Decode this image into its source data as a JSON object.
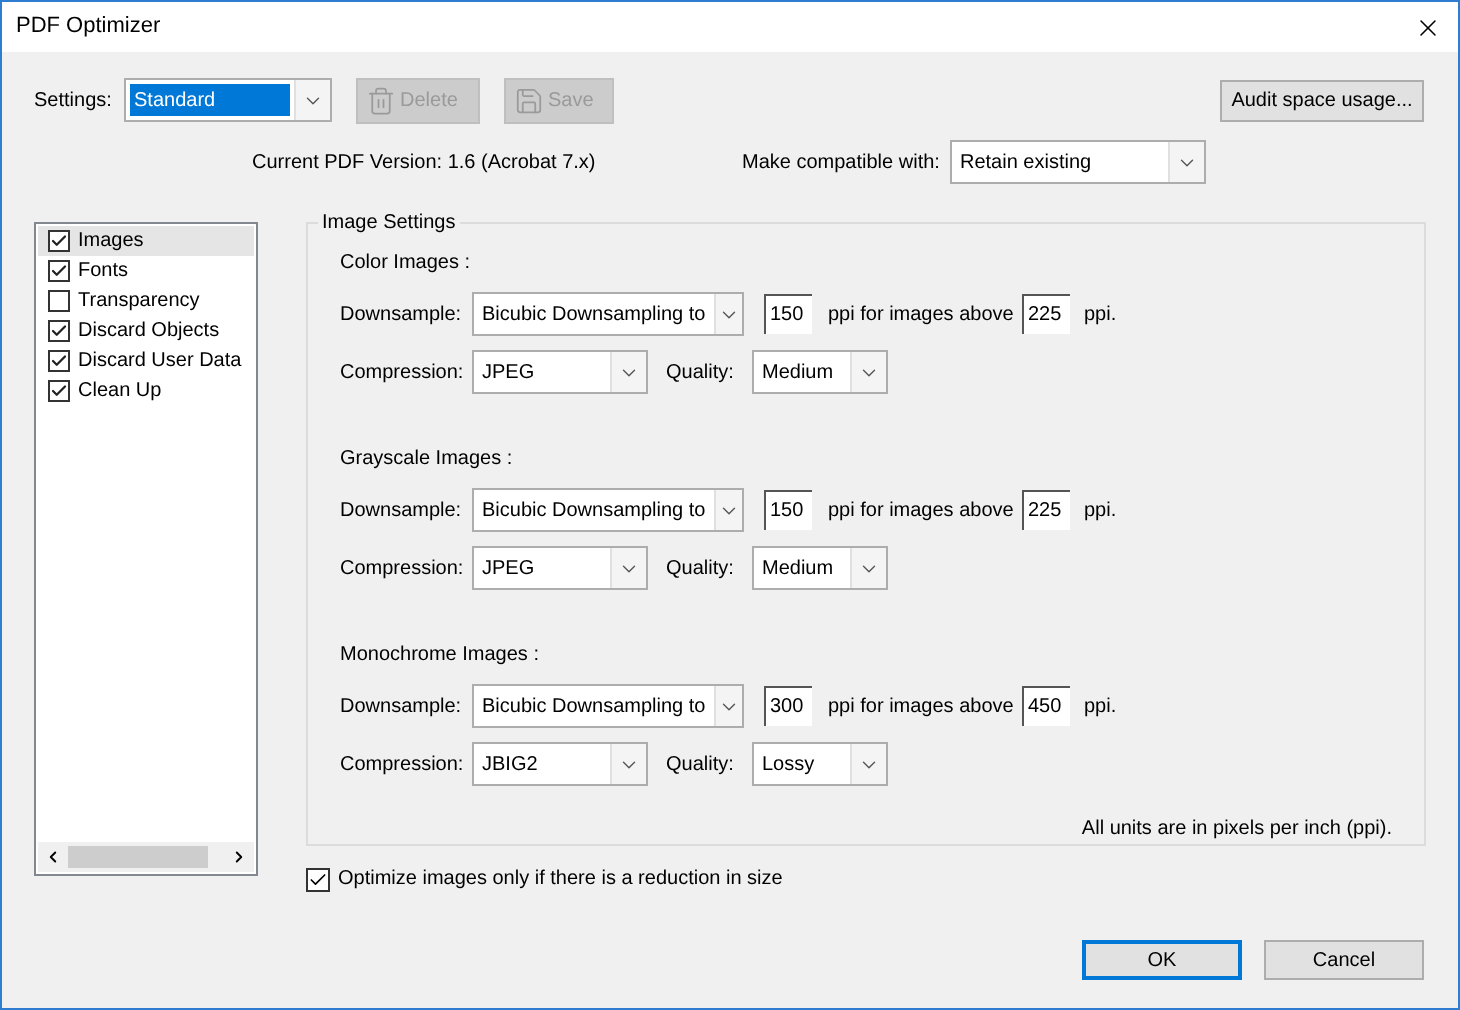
{
  "window": {
    "title": "PDF Optimizer"
  },
  "settings": {
    "label": "Settings:",
    "value": "Standard"
  },
  "toolbar_buttons": [
    {
      "label": "Delete",
      "disabled": true,
      "kind": "delete"
    },
    {
      "label": "Save",
      "disabled": true,
      "kind": "save"
    }
  ],
  "audit_button": "Audit space usage...",
  "current_version": "Current PDF Version: 1.6 (Acrobat 7.x)",
  "compatibility": {
    "label": "Make compatible with:",
    "value": "Retain existing"
  },
  "panels": [
    {
      "label": "Images",
      "checked": true,
      "selected": true
    },
    {
      "label": "Fonts",
      "checked": true,
      "selected": false
    },
    {
      "label": "Transparency",
      "checked": false,
      "selected": false
    },
    {
      "label": "Discard Objects",
      "checked": true,
      "selected": false
    },
    {
      "label": "Discard User Data",
      "checked": true,
      "selected": false
    },
    {
      "label": "Clean Up",
      "checked": true,
      "selected": false
    }
  ],
  "image_settings": {
    "title": "Image Settings",
    "sections": [
      {
        "title": "Color Images :",
        "downsample_label": "Downsample:",
        "downsample": "Bicubic Downsampling to",
        "ppi": "150",
        "ppi_text": "ppi for images above",
        "above": "225",
        "unit": "ppi.",
        "compression_label": "Compression:",
        "compression": "JPEG",
        "quality_label": "Quality:",
        "quality": "Medium"
      },
      {
        "title": "Grayscale Images :",
        "downsample_label": "Downsample:",
        "downsample": "Bicubic Downsampling to",
        "ppi": "150",
        "ppi_text": "ppi for images above",
        "above": "225",
        "unit": "ppi.",
        "compression_label": "Compression:",
        "compression": "JPEG",
        "quality_label": "Quality:",
        "quality": "Medium"
      },
      {
        "title": "Monochrome Images :",
        "downsample_label": "Downsample:",
        "downsample": "Bicubic Downsampling to",
        "ppi": "300",
        "ppi_text": "ppi for images above",
        "above": "450",
        "unit": "ppi.",
        "compression_label": "Compression:",
        "compression": "JBIG2",
        "quality_label": "Quality:",
        "quality": "Lossy"
      }
    ],
    "note": "All units are in pixels per inch (ppi)."
  },
  "optimize_option": {
    "label": "Optimize images only if there is a reduction in size",
    "checked": true
  },
  "buttons": [
    {
      "label": "OK",
      "default": true
    },
    {
      "label": "Cancel",
      "default": false
    }
  ]
}
